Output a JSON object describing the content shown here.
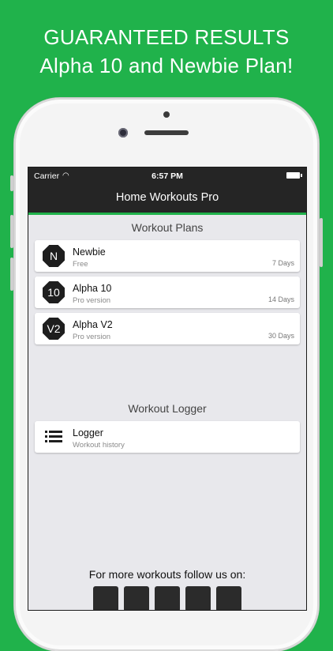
{
  "banner": {
    "line1": "GUARANTEED RESULTS",
    "line2": "Alpha 10 and Newbie Plan!"
  },
  "status_bar": {
    "carrier": "Carrier",
    "wifi_glyph": "◠",
    "time": "6:57 PM"
  },
  "navbar": {
    "title": "Home Workouts Pro"
  },
  "workout_plans": {
    "title": "Workout Plans",
    "items": [
      {
        "badge": "N",
        "title": "Newbie",
        "subtitle": "Free",
        "days": "7 Days"
      },
      {
        "badge": "10",
        "title": "Alpha 10",
        "subtitle": "Pro version",
        "days": "14 Days"
      },
      {
        "badge": "V2",
        "title": "Alpha V2",
        "subtitle": "Pro version",
        "days": "30 Days"
      }
    ]
  },
  "workout_logger": {
    "title": "Workout Logger",
    "items": [
      {
        "title": "Logger",
        "subtitle": "Workout history"
      }
    ]
  },
  "footer": {
    "follow_text": "For more workouts follow us on:",
    "social_icons": [
      "facebook-icon",
      "twitter-icon",
      "vine-icon",
      "google-plus-icon",
      "share-icon"
    ]
  },
  "colors": {
    "brand_green": "#20b24b",
    "nav_dark": "#252525",
    "screen_bg": "#e8e8ec"
  }
}
